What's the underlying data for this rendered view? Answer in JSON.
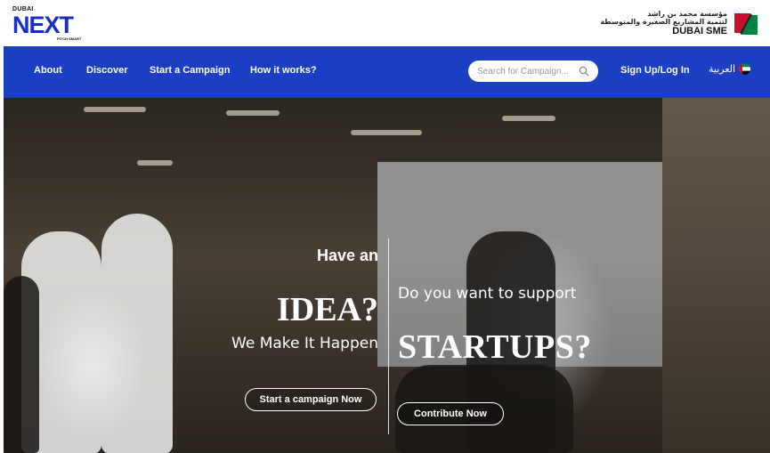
{
  "header": {
    "logo": {
      "top": "DUBAI",
      "main": "NEXT",
      "tagline": "PITCH SMART"
    },
    "sme_logo": {
      "arabic_line1": "مؤسسة محمد بن راشد",
      "arabic_line2": "لتنمية المشاريع الصغيرة والمتوسطة",
      "english": "DUBAI SME"
    }
  },
  "nav": {
    "items": [
      {
        "label": "About"
      },
      {
        "label": "Discover"
      },
      {
        "label": "Start a Campaign"
      },
      {
        "label": "How it works?"
      }
    ],
    "search": {
      "placeholder": "Search for Campaign...",
      "icon": "search-icon"
    },
    "signup_label": "Sign Up/Log In",
    "language_label": "العربية",
    "language_icon": "uae-flag-icon"
  },
  "hero": {
    "left": {
      "small": "Have an",
      "big": "IDEA?",
      "sub": "We Make It Happen",
      "button": "Start a campaign Now"
    },
    "right": {
      "small": "Do you want to support",
      "big": "STARTUPS?",
      "button": "Contribute Now"
    }
  },
  "colors": {
    "nav_blue": "#1b3fc3",
    "logo_blue": "#1a2fc2",
    "white": "#ffffff"
  }
}
